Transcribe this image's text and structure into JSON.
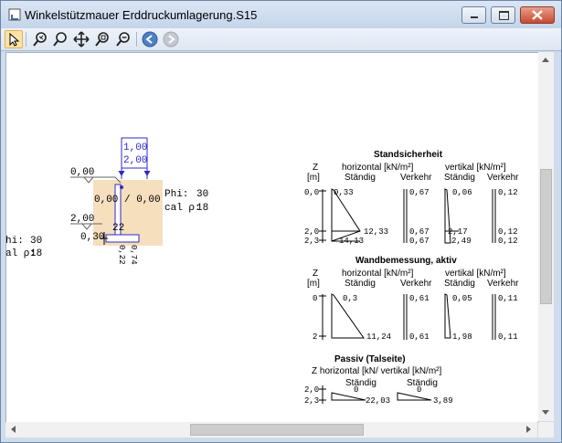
{
  "window": {
    "title": "Winkelstützmauer Erddruckumlagerung.S15"
  },
  "toolbar": {
    "buttons": [
      "pointer-icon",
      "zoom-user-icon",
      "zoom-in-icon",
      "pan-icon",
      "zoom-fit-icon",
      "zoom-out-icon",
      "back-icon",
      "forward-icon"
    ]
  },
  "drawing": {
    "surface_top": "0,00",
    "surface_bottom": "2,00",
    "load_top": "1,00",
    "load_bottom": "2,00",
    "ratio": "0,00 / 0,00",
    "phi_right_label": "Phi:",
    "phi_right_value": "30",
    "cal_right_label": "cal ρ:",
    "cal_right_value": "18",
    "phi_left_label": "hi:",
    "phi_left_value": "30",
    "cal_left_label": "al ρ:",
    "cal_left_value": "18",
    "dim_22": "22",
    "dim_030": "0,30",
    "dim_074": "0,74",
    "dim_022": "0,22"
  },
  "standsicherheit": {
    "heading": "Standsicherheit",
    "z": "Z",
    "zunit": "[m]",
    "horizontal": "horizontal [kN/m²]",
    "vertikal": "vertikal [kN/m²]",
    "staendig1": "Ständig",
    "verkehr1": "Verkehr",
    "staendig2": "Ständig",
    "verkehr2": "Verkehr",
    "z_top": "0,0",
    "z_mid": "2,0",
    "z_bot": "2,3",
    "h_s_top": "0,33",
    "h_s_mid": "12,33",
    "h_s_bot": "14,13",
    "h_v_top": "0,67",
    "h_v_mid": "0,67",
    "h_v_bot": "0,67",
    "v_s_top": "0,06",
    "v_s_mid": "2,17",
    "v_s_bot": "2,49",
    "v_v_top": "0,12",
    "v_v_mid": "0,12",
    "v_v_bot": "0,12"
  },
  "wandbemessung": {
    "heading": "Wandbemessung, aktiv",
    "z": "Z",
    "zunit": "[m]",
    "horizontal": "horizontal [kN/m²]",
    "vertikal": "vertikal [kN/m²]",
    "staendig1": "Ständig",
    "verkehr1": "Verkehr",
    "staendig2": "Ständig",
    "verkehr2": "Verkehr",
    "z_top": "0",
    "z_bot": "2",
    "h_s_top": "0,3",
    "h_s_bot": "11,24",
    "h_v_top": "0,61",
    "h_v_bot": "0,61",
    "v_s_top": "0,05",
    "v_s_bot": "1,98",
    "v_v_top": "0,11",
    "v_v_bot": "0,11"
  },
  "passiv": {
    "heading": "Passiv (Talseite)",
    "subheading": "Z horizontal [kN/ vertikal [kN/m²]",
    "staendig1": "Ständig",
    "staendig2": "Ständig",
    "z_top": "2,0",
    "z_bot": "2,3",
    "h_top": "0",
    "h_bot": "22,03",
    "v_top": "0",
    "v_bot": "3,89"
  }
}
